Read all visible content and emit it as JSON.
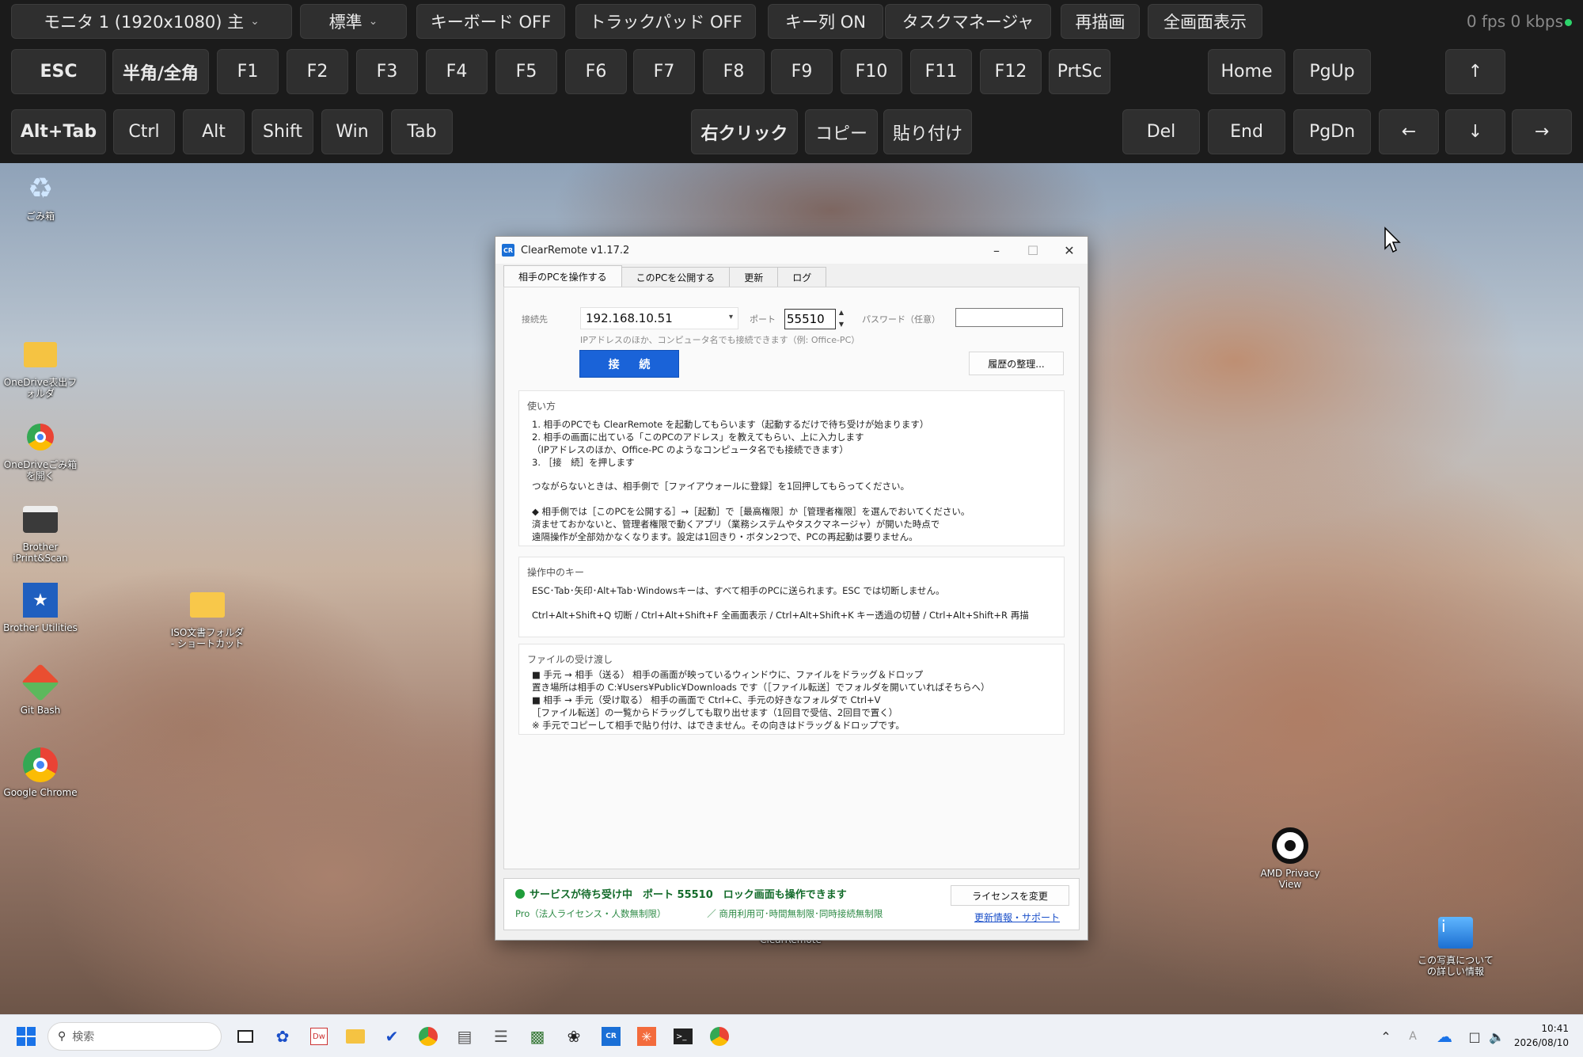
{
  "toolbar": {
    "row0": {
      "monitor_select": "モニタ 1 (1920x1080) 主",
      "quality_select": "標準",
      "keyboard_toggle": "キーボード OFF",
      "trackpad_toggle": "トラックパッド OFF",
      "keyrow_toggle": "キー列 ON",
      "task_manager": "タスクマネージャ",
      "redraw": "再描画",
      "fullscreen": "全画面表示",
      "stats": "0 fps 0 kbps"
    },
    "row1": {
      "esc": "ESC",
      "hankaku": "半角/全角",
      "f1": "F1",
      "f2": "F2",
      "f3": "F3",
      "f4": "F4",
      "f5": "F5",
      "f6": "F6",
      "f7": "F7",
      "f8": "F8",
      "f9": "F9",
      "f10": "F10",
      "f11": "F11",
      "f12": "F12",
      "prtsc": "PrtSc",
      "home": "Home",
      "pgup": "PgUp",
      "up": "↑"
    },
    "row2": {
      "alttab": "Alt+Tab",
      "ctrl": "Ctrl",
      "alt": "Alt",
      "shift": "Shift",
      "win": "Win",
      "tab": "Tab",
      "rightclick": "右クリック",
      "copy": "コピー",
      "paste": "貼り付け",
      "del": "Del",
      "end": "End",
      "pgdn": "PgDn",
      "left": "←",
      "down": "↓",
      "right": "→"
    }
  },
  "desktop": {
    "icons": {
      "recycle_bin": "ごみ箱",
      "onedrive_export": "OneDrive表出フォルダ",
      "onedrive_open": "OneDriveごみ箱を開く",
      "brother_iprint": "Brother iPrint&Scan",
      "brother_utilities": "Brother Utilities",
      "iso_shortcut": "ISO文書フォルダ - ショートカット",
      "git_bash": "Git Bash",
      "google_chrome": "Google Chrome",
      "clearremote": "ClearRemote",
      "amd_privacy": "AMD Privacy View",
      "photo_info": "この写真についての詳しい情報"
    }
  },
  "app": {
    "title": "ClearRemote v1.17.2",
    "logo": "CR",
    "tabs": [
      "相手のPCを操作する",
      "このPCを公開する",
      "更新",
      "ログ"
    ],
    "connect": {
      "dest_label": "接続先",
      "dest_value": "192.168.10.51",
      "port_label": "ポート",
      "port_value": "55510",
      "password_label": "パスワード（任意）",
      "hint": "IPアドレスのほか、コンピュータ名でも接続できます（例: Office-PC）",
      "connect_button": "接 続",
      "history_button": "履歴の整理..."
    },
    "usage": {
      "title": "使い方",
      "lines": [
        "1.  相手のPCでも ClearRemote を起動してもらいます（起動するだけで待ち受けが始まります）",
        "2.  相手の画面に出ている「このPCのアドレス」を教えてもらい、上に入力します",
        "      （IPアドレスのほか、Office-PC のようなコンピュータ名でも接続できます）",
        "3.  ［接　続］を押します",
        "つながらないときは、相手側で［ファイアウォールに登録］を1回押してもらってください。",
        "◆ 相手側では［このPCを公開する］→［起動］で［最高権限］か［管理者権限］を選んでおいてください。",
        "     済ませておかないと、管理者権限で動くアプリ（業務システムやタスクマネージャ）が開いた時点で",
        "     遠隔操作が全部効かなくなります。設定は1回きり・ボタン2つで、PCの再起動は要りません。"
      ]
    },
    "keys": {
      "title": "操作中のキー",
      "lines": [
        "ESC･Tab･矢印･Alt+Tab･Windowsキーは、すべて相手のPCに送られます。ESC では切断しません。",
        "Ctrl+Alt+Shift+Q 切断  /  Ctrl+Alt+Shift+F 全画面表示  /  Ctrl+Alt+Shift+K キー透過の切替  /  Ctrl+Alt+Shift+R 再描"
      ]
    },
    "files": {
      "title": "ファイルの受け渡し",
      "lines": [
        "■ 手元 → 相手（送る）        相手の画面が映っているウィンドウに、ファイルをドラッグ＆ドロップ",
        "      置き場所は相手の C:¥Users¥Public¥Downloads です（［ファイル転送］でフォルダを開いていればそちらへ）",
        "■ 相手 → 手元（受け取る） 相手の画面で Ctrl+C、手元の好きなフォルダで Ctrl+V",
        "      ［ファイル転送］の一覧からドラッグしても取り出せます（1回目で受信、2回目で置く）",
        "※ 手元でコピーして相手で貼り付け、はできません。その向きはドラッグ＆ドロップです。"
      ]
    },
    "status": {
      "main": "サービスが待ち受け中　ポート 55510　ロック画面も操作できます",
      "sub": "Pro（法人ライセンス・人数無制限）　　　　　／ 商用利用可･時間無制限･同時接続無制限",
      "license_button": "ライセンスを変更",
      "support_link": "更新情報・サポート"
    }
  },
  "taskbar": {
    "search_placeholder": "検索",
    "time": "10:41",
    "date": "2026/08/10"
  }
}
